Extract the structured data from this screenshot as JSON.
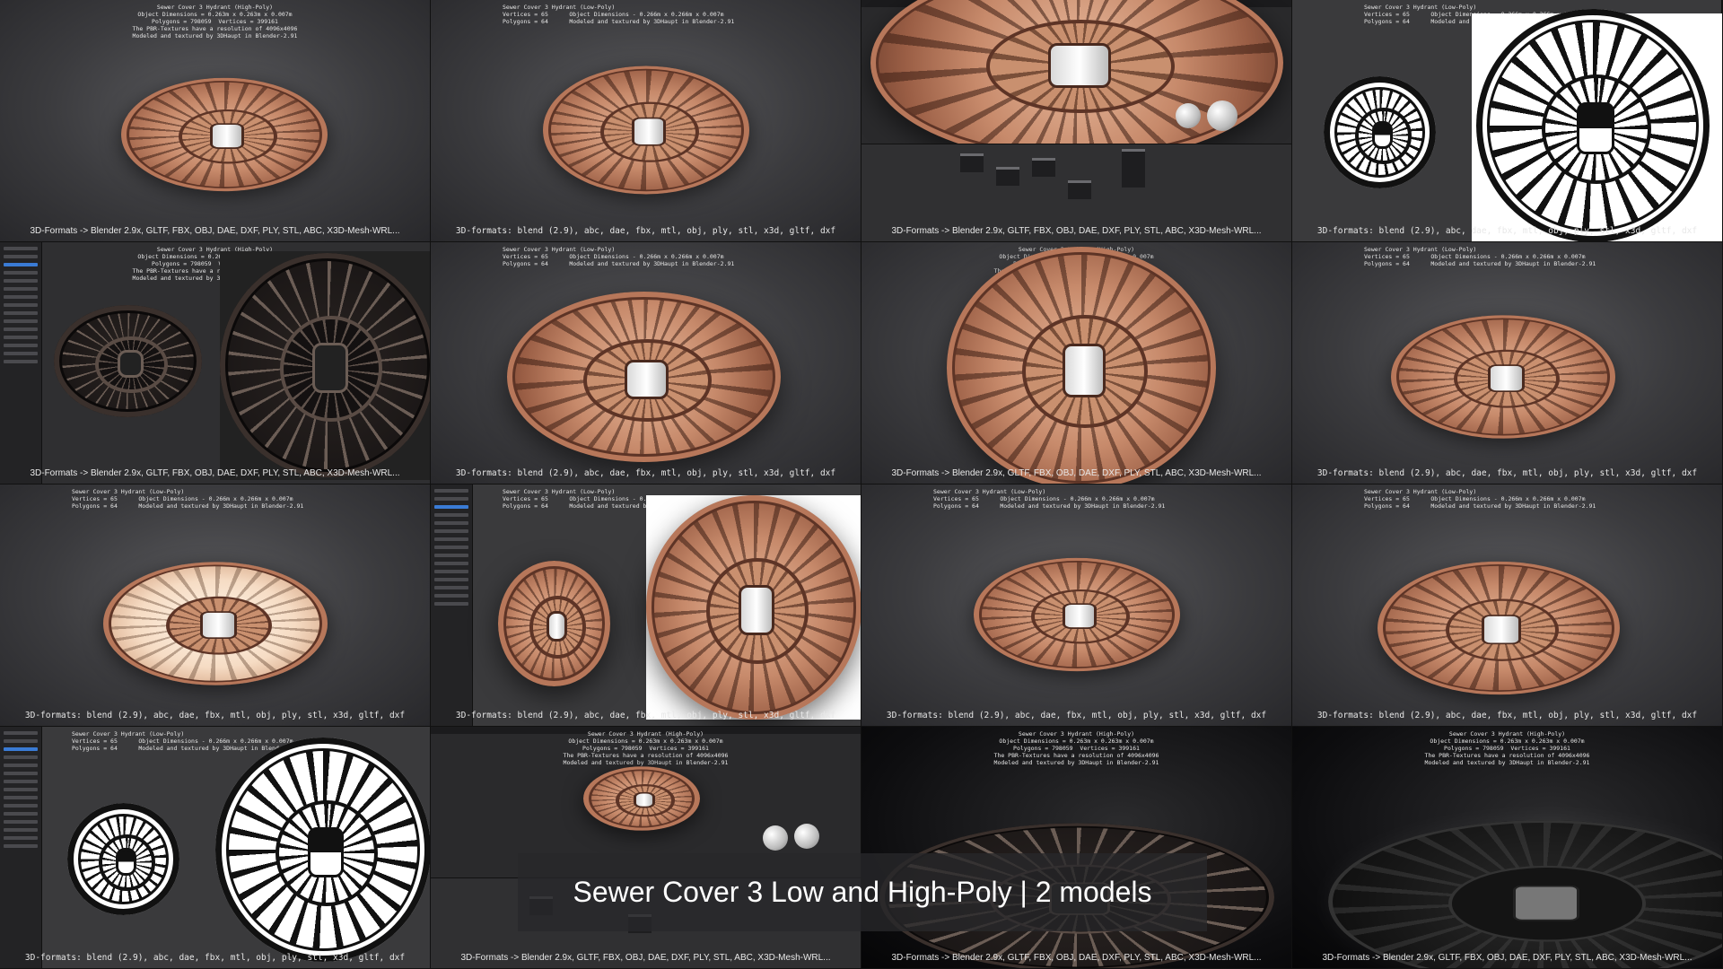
{
  "high_poly_info": "Sewer Cover 3 Hydrant (High-Poly)\nObject Dimensions = 0.263m x 0.263m x 0.007m\nPolygons = 798059  Vertices = 399161\nThe PBR-Textures have a resolution of 4096x4096\nModeled and textured by 3DHaupt in Blender-2.91",
  "low_poly_info": "Sewer Cover 3 Hydrant (Low-Poly)\nVertices = 65      Object Dimensions - 0.266m x 0.266m x 0.007m\nPolygons = 64      Modeled and textured by 3DHaupt in Blender-2.91",
  "formats_high": "3D-Formats -> Blender 2.9x, GLTF, FBX, OBJ, DAE, DXF, PLY, STL, ABC, X3D-Mesh-WRL...",
  "formats_low": "3D-formats: blend (2.9), abc, dae, fbx, mtl, obj, ply, stl, x3d, gltf, dxf",
  "caption": "Sewer Cover 3 Low and High-Poly | 2 models"
}
